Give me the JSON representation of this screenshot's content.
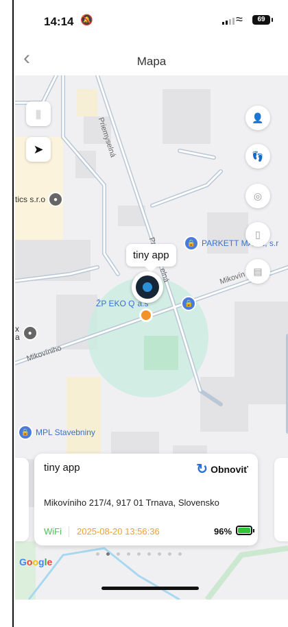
{
  "status_bar": {
    "time": "14:14",
    "battery": "69"
  },
  "nav": {
    "back_glyph": "‹",
    "title": "Mapa"
  },
  "map": {
    "streets": [
      "Priemyselná",
      "Pr",
      "elná",
      "Mikovín",
      "Mikovíniho"
    ],
    "pois": [
      {
        "label": "tics s.r.o"
      },
      {
        "label": "PARKETT MAXN, s.r"
      },
      {
        "label": "ŽP EKO Q",
        "label2": "a.s"
      },
      {
        "label": "x",
        "label2": "a"
      },
      {
        "label": "MPL Stavebniny"
      }
    ],
    "device_tooltip": "tiny app",
    "right_tools": [
      "person-icon",
      "footsteps-icon",
      "geofence-icon",
      "phone-icon",
      "layers-icon"
    ]
  },
  "card": {
    "device_name": "tiny app",
    "refresh_label": "Obnoviť",
    "address": "Mikovíniho 217/4, 917 01 Trnava, Slovensko",
    "connection": "WiFi",
    "timestamp": "2025-08-20 13:56:36",
    "battery": "96%"
  },
  "pager": {
    "count": 9,
    "active": 1
  },
  "google_logo": "Google"
}
